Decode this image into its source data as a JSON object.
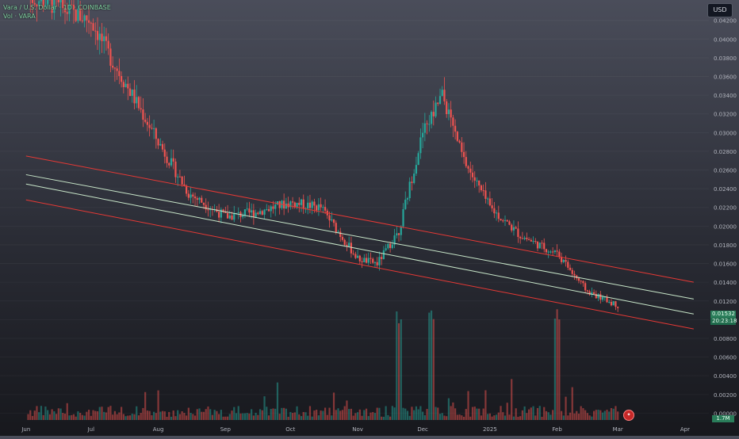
{
  "header": {
    "title": "Vara / U.S. Dollar · 1D · COINBASE",
    "volume_label": "Vol · VARA",
    "currency_button": "USD"
  },
  "price_tags": {
    "last_price": "0.01532",
    "countdown": "20:23:18",
    "volume": "1.7M"
  },
  "colors": {
    "up": "#26a69a",
    "down": "#ef5350",
    "channel_outer": "#e53935",
    "channel_inner": "#c8e6c9"
  },
  "icons": {
    "symbol_logo": "vara-logo-icon"
  },
  "chart_data": {
    "type": "candlestick",
    "title": "Vara / U.S. Dollar · 1D · COINBASE",
    "y_ticks": [
      "0.04200",
      "0.04000",
      "0.03800",
      "0.03600",
      "0.03400",
      "0.03200",
      "0.03000",
      "0.02800",
      "0.02600",
      "0.02400",
      "0.02200",
      "0.02000",
      "0.01800",
      "0.01600",
      "0.01400",
      "0.01200",
      "0.01000",
      "0.00800",
      "0.00600",
      "0.00400",
      "0.00200",
      "0.00000"
    ],
    "x_ticks": [
      "Jun",
      "Jul",
      "Aug",
      "Sep",
      "Oct",
      "Nov",
      "Dec",
      "2025",
      "Feb",
      "Mar",
      "Apr"
    ],
    "ylim": [
      0.0,
      0.0435
    ],
    "series": [
      {
        "name": "Price",
        "x": [
          "2024-06-01",
          "2024-06-10",
          "2024-06-20",
          "2024-07-01",
          "2024-07-10",
          "2024-07-20",
          "2024-08-01",
          "2024-08-15",
          "2024-09-01",
          "2024-09-15",
          "2024-10-01",
          "2024-10-15",
          "2024-11-01",
          "2024-11-10",
          "2024-11-20",
          "2024-12-01",
          "2024-12-10",
          "2024-12-20",
          "2025-01-01",
          "2025-01-15",
          "2025-02-01",
          "2025-02-15",
          "2025-03-01"
        ],
        "close": [
          0.0445,
          0.044,
          0.043,
          0.042,
          0.038,
          0.034,
          0.029,
          0.0235,
          0.021,
          0.0215,
          0.0225,
          0.022,
          0.0165,
          0.016,
          0.0195,
          0.03,
          0.034,
          0.027,
          0.022,
          0.019,
          0.017,
          0.013,
          0.0115
        ]
      }
    ],
    "channel": {
      "upper": {
        "start": [
          "2024-06-01",
          0.0275
        ],
        "end": [
          "2025-04-05",
          0.014
        ]
      },
      "mid_upper": {
        "start": [
          "2024-06-01",
          0.0255
        ],
        "end": [
          "2025-04-05",
          0.0122
        ]
      },
      "mid_lower": {
        "start": [
          "2024-06-01",
          0.0245
        ],
        "end": [
          "2025-04-05",
          0.0106
        ]
      },
      "lower": {
        "start": [
          "2024-06-01",
          0.0228
        ],
        "end": [
          "2025-04-05",
          0.009
        ]
      }
    },
    "volume_spikes": [
      "2024-11-20",
      "2024-12-05",
      "2025-02-01"
    ]
  }
}
